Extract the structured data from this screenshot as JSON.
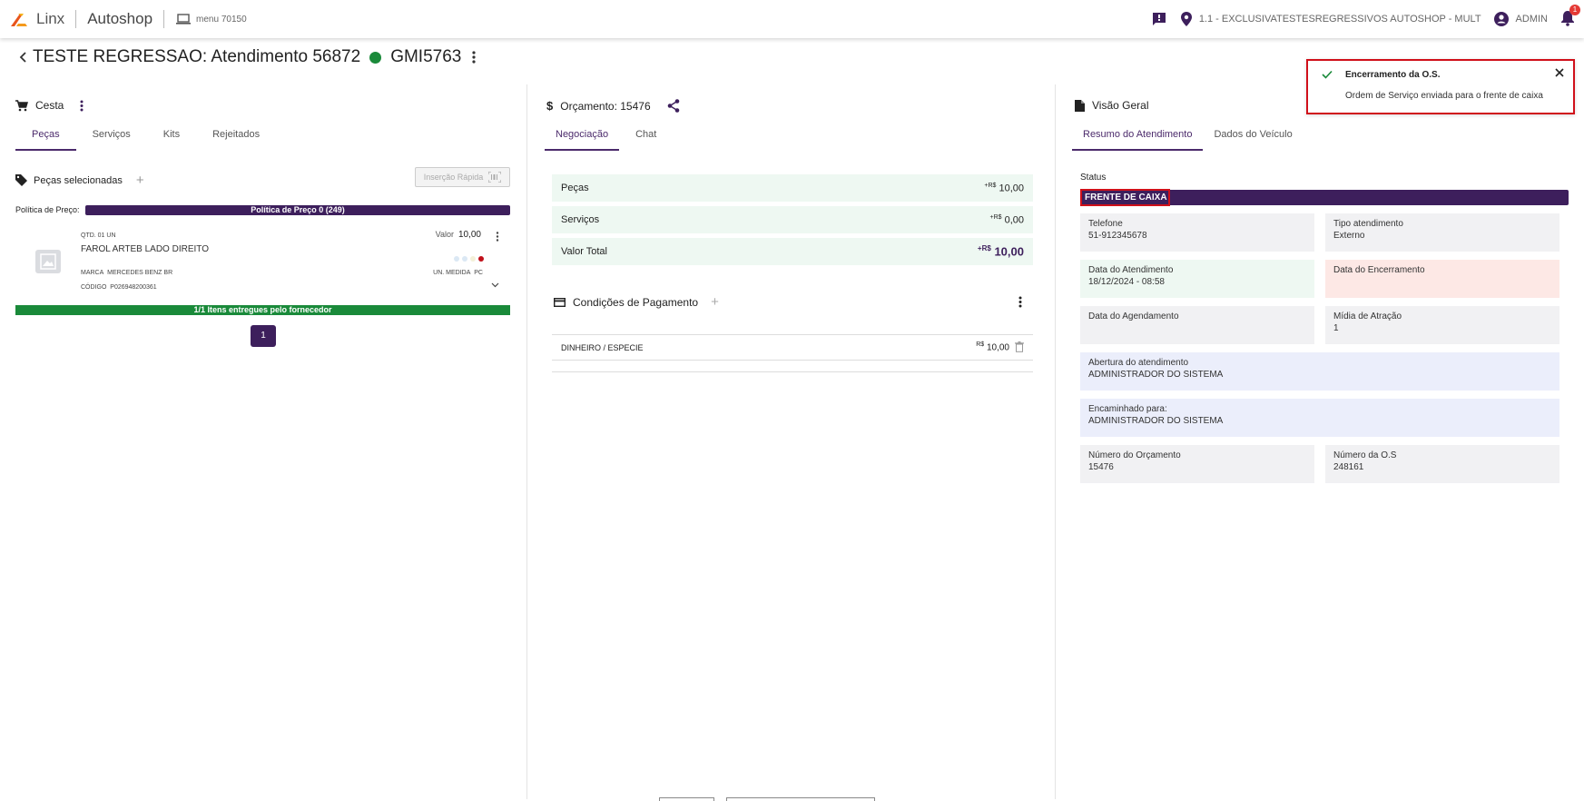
{
  "topbar": {
    "brand": "Linx",
    "app_name": "Autoshop",
    "menu_label": "menu 70150",
    "location": "1.1 - EXCLUSIVATESTESREGRESSIVOS AUTOSHOP - MULT",
    "user": "ADMIN",
    "notification_count": "1"
  },
  "header": {
    "title": "TESTE REGRESSAO: Atendimento 56872",
    "plate": "GMI5763",
    "status_color": "#1a8a3a"
  },
  "cesta": {
    "title": "Cesta",
    "tabs": [
      "Peças",
      "Serviços",
      "Kits",
      "Rejeitados"
    ],
    "selected_label": "Peças selecionadas",
    "quick_insert": "Inserção Rápida",
    "price_policy_label": "Política de Preço:",
    "price_policy_value": "Política de Preço 0 (249)",
    "item": {
      "qty": "QTD. 01 UN",
      "value_label": "Valor",
      "value": "10,00",
      "name": "FAROL ARTEB LADO DIREITO",
      "brand_label": "MARCA",
      "brand": "MERCEDES BENZ BR",
      "unit_label": "UN. MEDIDA",
      "unit": "PC",
      "code_label": "CÓDIGO",
      "code": "P026948200361"
    },
    "delivered": "1/1 Itens entregues pelo fornecedor",
    "page": "1"
  },
  "orcamento": {
    "title": "Orçamento: 15476",
    "tabs": [
      "Negociação",
      "Chat"
    ],
    "currency": "R$",
    "rows": [
      {
        "label": "Peças",
        "value": "10,00"
      },
      {
        "label": "Serviços",
        "value": "0,00"
      },
      {
        "label": "Valor Total",
        "value": "10,00"
      }
    ],
    "payment_title": "Condições de Pagamento",
    "payment_method": "DINHEIRO / ESPECIE",
    "payment_value": "10,00"
  },
  "visao": {
    "title": "Visão Geral",
    "tabs": [
      "Resumo do Atendimento",
      "Dados do Veículo"
    ],
    "status_label": "Status",
    "status_value": "FRENTE DE CAIXA",
    "cards": {
      "telefone_label": "Telefone",
      "telefone": "51-912345678",
      "tipo_label": "Tipo atendimento",
      "tipo": "Externo",
      "data_atend_label": "Data do Atendimento",
      "data_atend": "18/12/2024 - 08:58",
      "data_enc_label": "Data do Encerramento",
      "data_agend_label": "Data do Agendamento",
      "midia_label": "Mídia de Atração",
      "midia": "1",
      "abertura_label": "Abertura do atendimento",
      "abertura": "ADMINISTRADOR DO SISTEMA",
      "encaminhado_label": "Encaminhado para:",
      "encaminhado": "ADMINISTRADOR DO SISTEMA",
      "num_orc_label": "Número do Orçamento",
      "num_orc": "15476",
      "num_os_label": "Número da O.S",
      "num_os": "248161"
    }
  },
  "toast": {
    "title": "Encerramento da O.S.",
    "message": "Ordem de Serviço enviada para o frente de caixa"
  },
  "colors": {
    "primary": "#4b2a6b",
    "success": "#1a8a3a",
    "highlight": "#d0101a",
    "brand_orange": "#e8541c"
  }
}
